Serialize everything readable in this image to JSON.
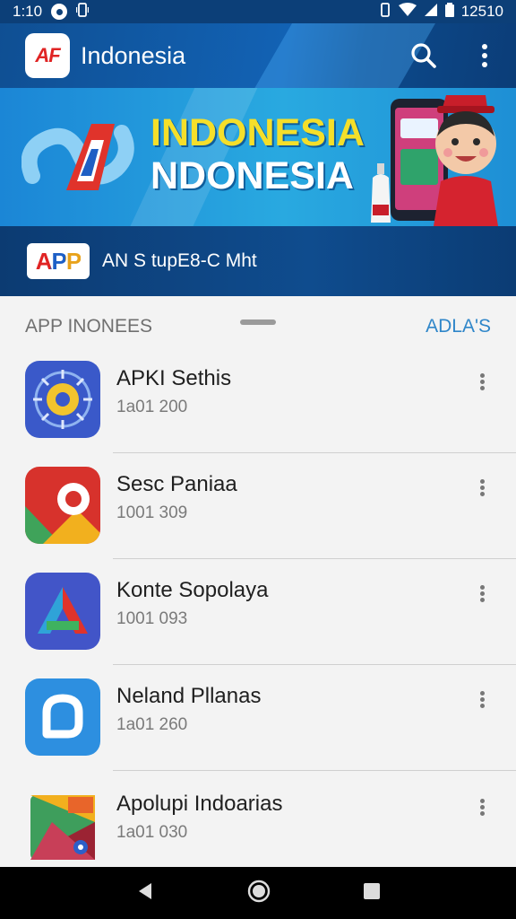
{
  "status_bar": {
    "time": "1:10",
    "right_text": "12510",
    "icons": [
      "notification-dot-icon",
      "vibrate-icon",
      "wifi-icon",
      "signal-icon",
      "battery-icon"
    ]
  },
  "app_bar": {
    "logo_text": "AF",
    "title": "Indonesia",
    "icons": [
      "search-icon",
      "more-vert-icon"
    ]
  },
  "banner": {
    "line1": "INDONESIA",
    "line2": "NDONESIA"
  },
  "promo": {
    "badge_text": "APP",
    "text": "AN S tupE8-C Mht"
  },
  "section": {
    "title": "APP INONEES",
    "action": "ADLA'S"
  },
  "apps": [
    {
      "name": "APKI Sethis",
      "meta": "1a01 200",
      "icon": "compass-app-icon"
    },
    {
      "name": "Sesc Paniaa",
      "meta": "1001 309",
      "icon": "maps-app-icon"
    },
    {
      "name": "Konte Sopolaya",
      "meta": "1001 093",
      "icon": "triangle-app-icon"
    },
    {
      "name": "Neland Pllanas",
      "meta": "1a01 260",
      "icon": "rounded-square-app-icon"
    },
    {
      "name": "Apolupi Indoarias",
      "meta": "1a01 030",
      "icon": "media-app-icon"
    }
  ],
  "nav": {
    "icons": [
      "back-icon",
      "home-icon",
      "recents-icon"
    ]
  },
  "colors": {
    "app_bar": "#1262b4",
    "banner": "#29a9e0",
    "accent_link": "#2f86c9"
  }
}
